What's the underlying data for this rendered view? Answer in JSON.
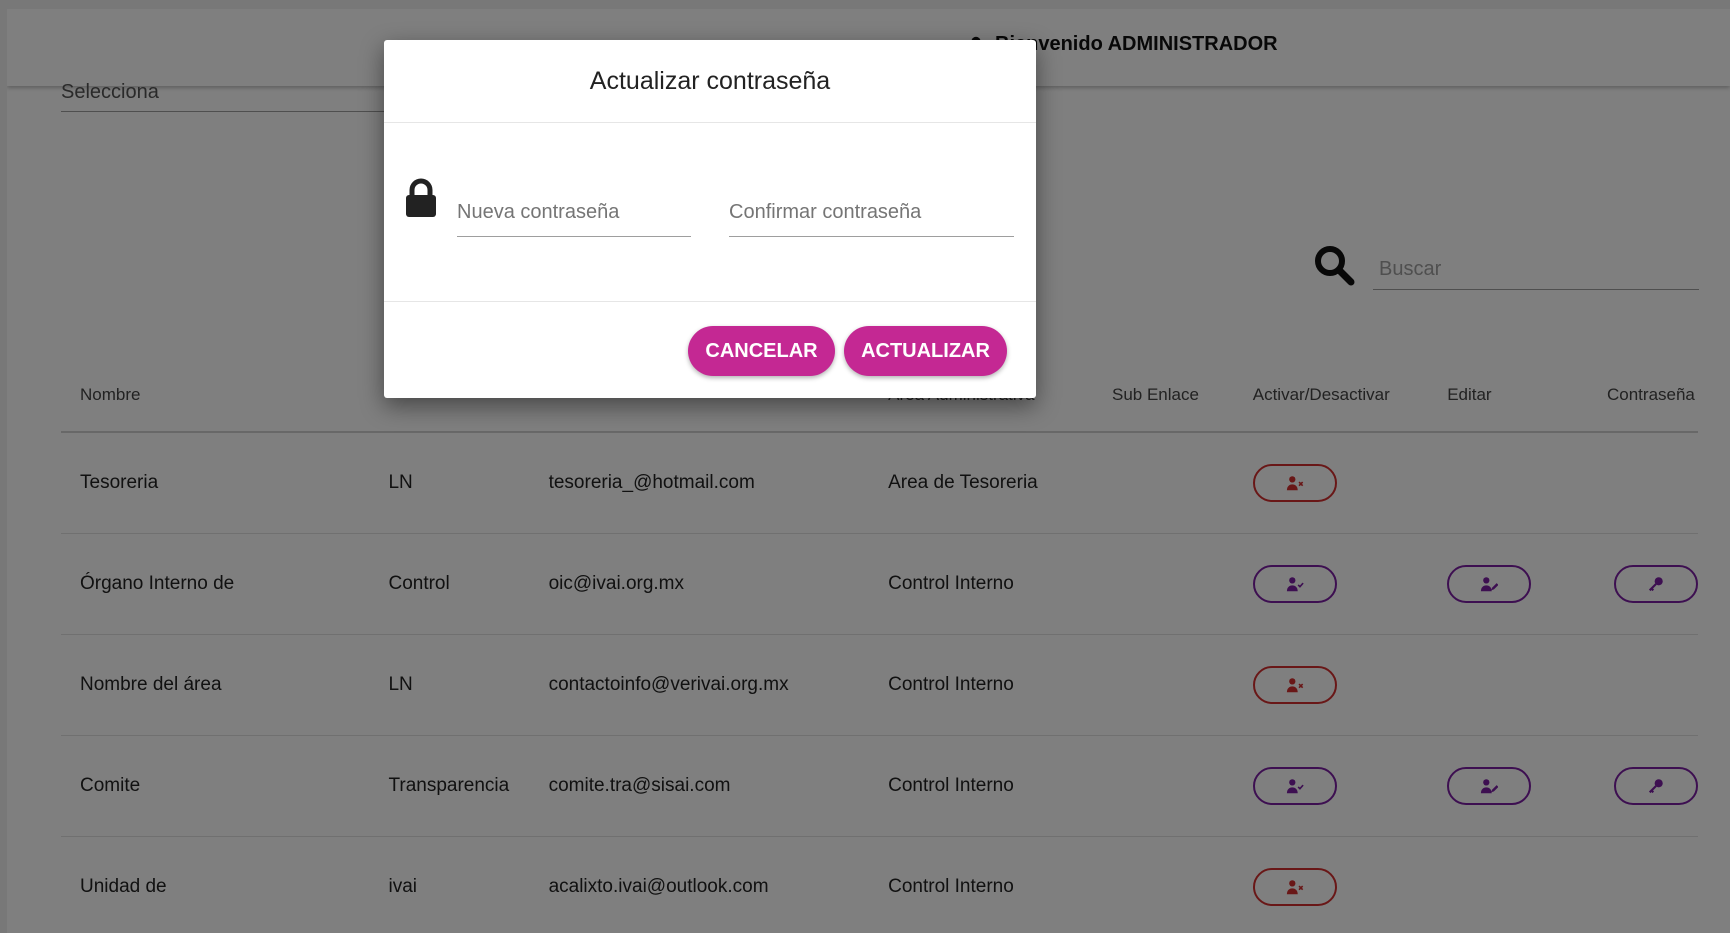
{
  "header": {
    "welcome": "Bienvenido ADMINISTRADOR"
  },
  "filter": {
    "select_text": "Selecciona"
  },
  "search": {
    "placeholder": "Buscar"
  },
  "table": {
    "headers": {
      "nombre": "Nombre",
      "area": "Area Administrativa",
      "sub": "Sub Enlace",
      "activar": "Activar/Desactivar",
      "editar": "Editar",
      "password": "Contraseña"
    },
    "rows": [
      {
        "nombre": "Tesoreria",
        "col2": "LN",
        "correo": "tesoreria_@hotmail.com",
        "area": "Area de Tesoreria",
        "status": "inactive",
        "editable": false
      },
      {
        "nombre": "Órgano Interno de",
        "col2": "Control",
        "correo": "oic@ivai.org.mx",
        "area": "Control Interno",
        "status": "active",
        "editable": true
      },
      {
        "nombre": "Nombre del área",
        "col2": "LN",
        "correo": "contactoinfo@verivai.org.mx",
        "area": "Control Interno",
        "status": "inactive",
        "editable": false
      },
      {
        "nombre": "Comite",
        "col2": "Transparencia",
        "correo": "comite.tra@sisai.com",
        "area": "Control Interno",
        "status": "active",
        "editable": true
      },
      {
        "nombre": "Unidad de",
        "col2": "ivai",
        "correo": "acalixto.ivai@outlook.com",
        "area": "Control Interno",
        "status": "inactive",
        "editable": false
      }
    ]
  },
  "modal": {
    "title": "Actualizar contraseña",
    "new_password_placeholder": "Nueva contraseña",
    "confirm_password_placeholder": "Confirmar contraseña",
    "cancel_label": "CANCELAR",
    "update_label": "ACTUALIZAR"
  },
  "colors": {
    "accent": "#c42893",
    "danger": "#d32f2f",
    "purple": "#7b1fa2"
  },
  "icons": {
    "user": "user-icon",
    "search": "search-icon",
    "lock": "lock-icon",
    "user_x": "user-x-icon",
    "user_check": "user-check-icon",
    "user_edit": "user-edit-icon",
    "key": "key-icon"
  }
}
